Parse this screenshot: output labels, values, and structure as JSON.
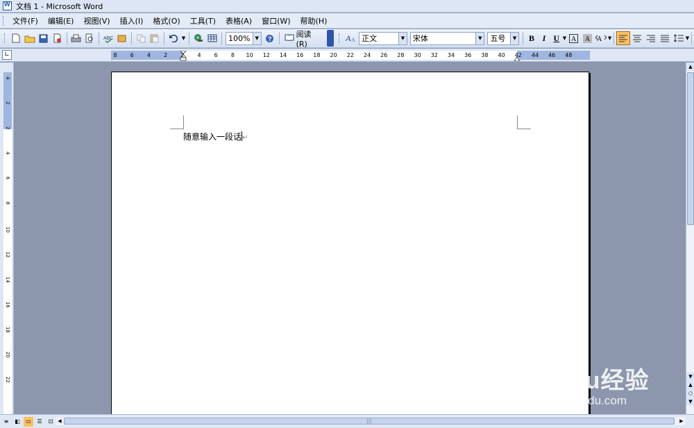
{
  "window": {
    "title": "文档 1 - Microsoft Word"
  },
  "menu": {
    "items": [
      {
        "label": "文件(F)"
      },
      {
        "label": "编辑(E)"
      },
      {
        "label": "视图(V)"
      },
      {
        "label": "插入(I)"
      },
      {
        "label": "格式(O)"
      },
      {
        "label": "工具(T)"
      },
      {
        "label": "表格(A)"
      },
      {
        "label": "窗口(W)"
      },
      {
        "label": "帮助(H)"
      }
    ]
  },
  "toolbar": {
    "zoom": "100%",
    "read_label": "阅读(R)",
    "style": "正文",
    "font": "宋体",
    "size": "五号",
    "bold": "B",
    "italic": "I",
    "underline": "U"
  },
  "ruler": {
    "h_ticks": [
      "8",
      "6",
      "4",
      "2",
      "2",
      "4",
      "6",
      "8",
      "10",
      "12",
      "14",
      "16",
      "18",
      "20",
      "22",
      "24",
      "26",
      "28",
      "30",
      "32",
      "34",
      "36",
      "38",
      "40",
      "42",
      "44",
      "46",
      "48"
    ],
    "v_ticks": [
      "4",
      "2",
      "2",
      "4",
      "6",
      "8",
      "10",
      "12",
      "14",
      "16",
      "18",
      "20",
      "22"
    ]
  },
  "document": {
    "text": "随意输入一段话"
  },
  "watermark": {
    "logo": "Baidu经验",
    "url": "jingyan.baidu.com"
  },
  "colors": {
    "title_bg": "#dce6f4",
    "workspace": "#8c97ad",
    "ruler_margin": "#9fb6e0",
    "active_button": "#f9c164"
  }
}
